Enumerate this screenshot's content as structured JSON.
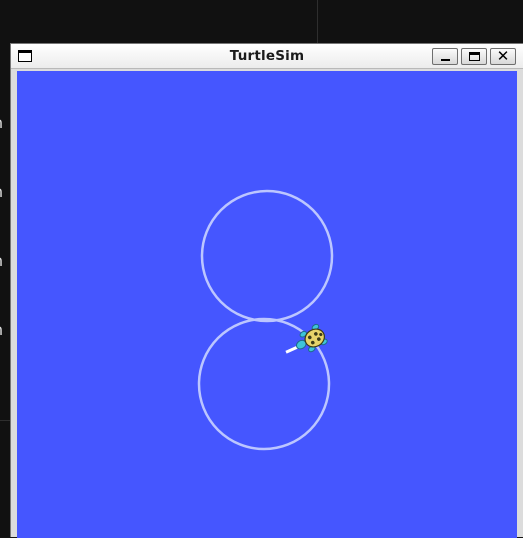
{
  "window": {
    "title": "TurtleSim",
    "buttons": {
      "minimize_icon": "minimize-icon",
      "maximize_icon": "maximize-icon",
      "close_glyph": "✕"
    }
  },
  "terminal": {
    "partial_lines": [
      "n",
      "n",
      "n",
      "n"
    ]
  },
  "canvas": {
    "background_color": "#4556ff",
    "path_color": "#bcc6ff",
    "trail_shape": "figure-eight",
    "turtle_icon": "turtle-icon"
  },
  "colors": {
    "titlebar": "#f0f0f0",
    "desktop": "#111111"
  }
}
